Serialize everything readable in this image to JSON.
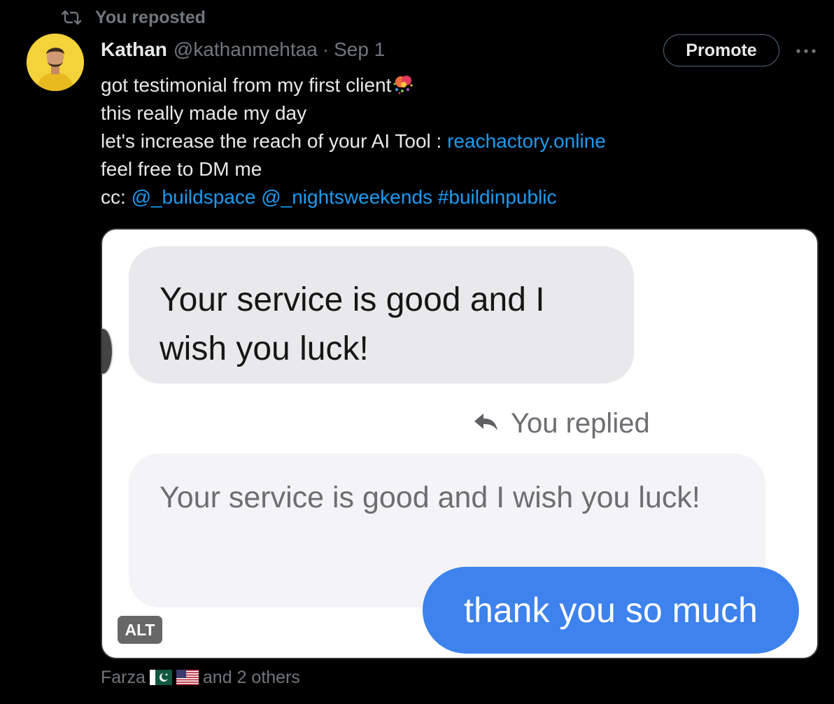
{
  "repost": {
    "label": "You reposted",
    "icon": "repost-icon"
  },
  "author": {
    "name": "Kathan",
    "handle": "@kathanmehtaa",
    "separator": "·",
    "date": "Sep 1"
  },
  "actions": {
    "promote_label": "Promote",
    "more_icon": "more-icon"
  },
  "tweet": {
    "line1": "got testimonial from my first client",
    "line1_emoji": "party-popper-emoji",
    "line2": "this really made my day",
    "line3_text": "let's increase the reach of your AI Tool : ",
    "line3_link": "reachactory.online",
    "line4": "feel free to DM me",
    "line5_prefix": "cc: ",
    "mention1": "@_buildspace",
    "mention2": "@_nightsweekends",
    "hashtag": "#buildinpublic"
  },
  "media": {
    "message_received": "Your service is good and I wish you luck!",
    "replied_label": "You replied",
    "quoted_message": "Your service is good and I wish you luck!",
    "reply_message": "thank you so much",
    "alt_label": "ALT"
  },
  "likes": {
    "name": "Farza",
    "flags": [
      "pakistan-flag",
      "usa-flag"
    ],
    "suffix": "and 2 others"
  },
  "colors": {
    "background": "#000000",
    "link": "#1d9bf0",
    "muted": "#71767b",
    "reply_bubble": "#3d82ed",
    "avatar_bg": "#f4d23a"
  }
}
